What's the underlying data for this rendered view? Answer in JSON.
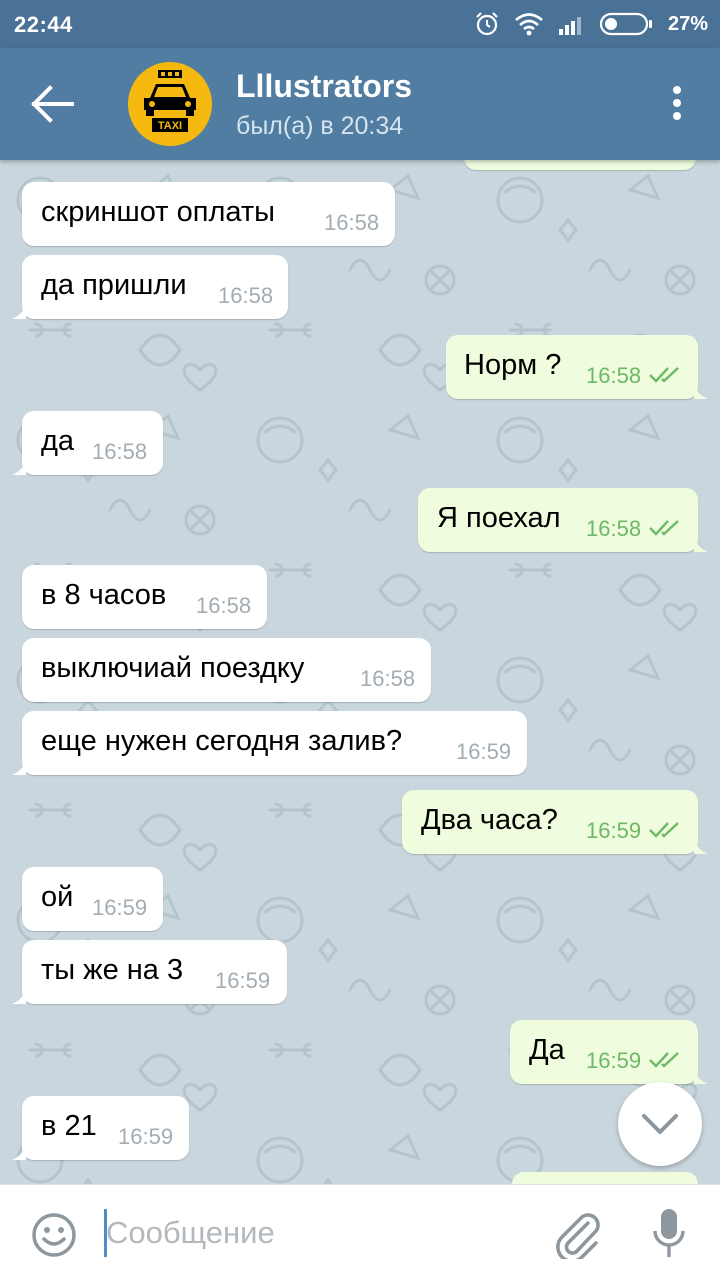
{
  "status_bar": {
    "time": "22:44",
    "battery": "27%"
  },
  "header": {
    "title": "Lllustrators",
    "subtitle": "был(а) в 20:34",
    "avatar_label": "TAXI"
  },
  "messages": [
    {
      "dir": "in",
      "text": "скриншот оплаты",
      "time": "16:58"
    },
    {
      "dir": "in",
      "text": "да пришли",
      "time": "16:58"
    },
    {
      "dir": "out",
      "text": "Норм ?",
      "time": "16:58"
    },
    {
      "dir": "in",
      "text": "да",
      "time": "16:58"
    },
    {
      "dir": "out",
      "text": "Я поехал",
      "time": "16:58"
    },
    {
      "dir": "in",
      "text": "в 8 часов",
      "time": "16:58"
    },
    {
      "dir": "in",
      "text": "выключиай поездку",
      "time": "16:58"
    },
    {
      "dir": "in",
      "text": "еще нужен сегодня залив?",
      "time": "16:59"
    },
    {
      "dir": "out",
      "text": "Два часа?",
      "time": "16:59"
    },
    {
      "dir": "in",
      "text": "ой",
      "time": "16:59"
    },
    {
      "dir": "in",
      "text": "ты же на 3",
      "time": "16:59"
    },
    {
      "dir": "out",
      "text": "Да",
      "time": "16:59"
    },
    {
      "dir": "in",
      "text": "в 21",
      "time": "16:59"
    }
  ],
  "input": {
    "placeholder": "Сообщение"
  },
  "icons": [
    "back-arrow-icon",
    "more-vert-icon",
    "chevron-down-icon",
    "emoji-icon",
    "paperclip-icon",
    "microphone-icon",
    "double-check-icon"
  ],
  "colors": {
    "header": "#517da2",
    "status_bar": "#4a7296",
    "incoming": "#ffffff",
    "outgoing": "#effdde",
    "outgoing_time": "#6db965"
  }
}
